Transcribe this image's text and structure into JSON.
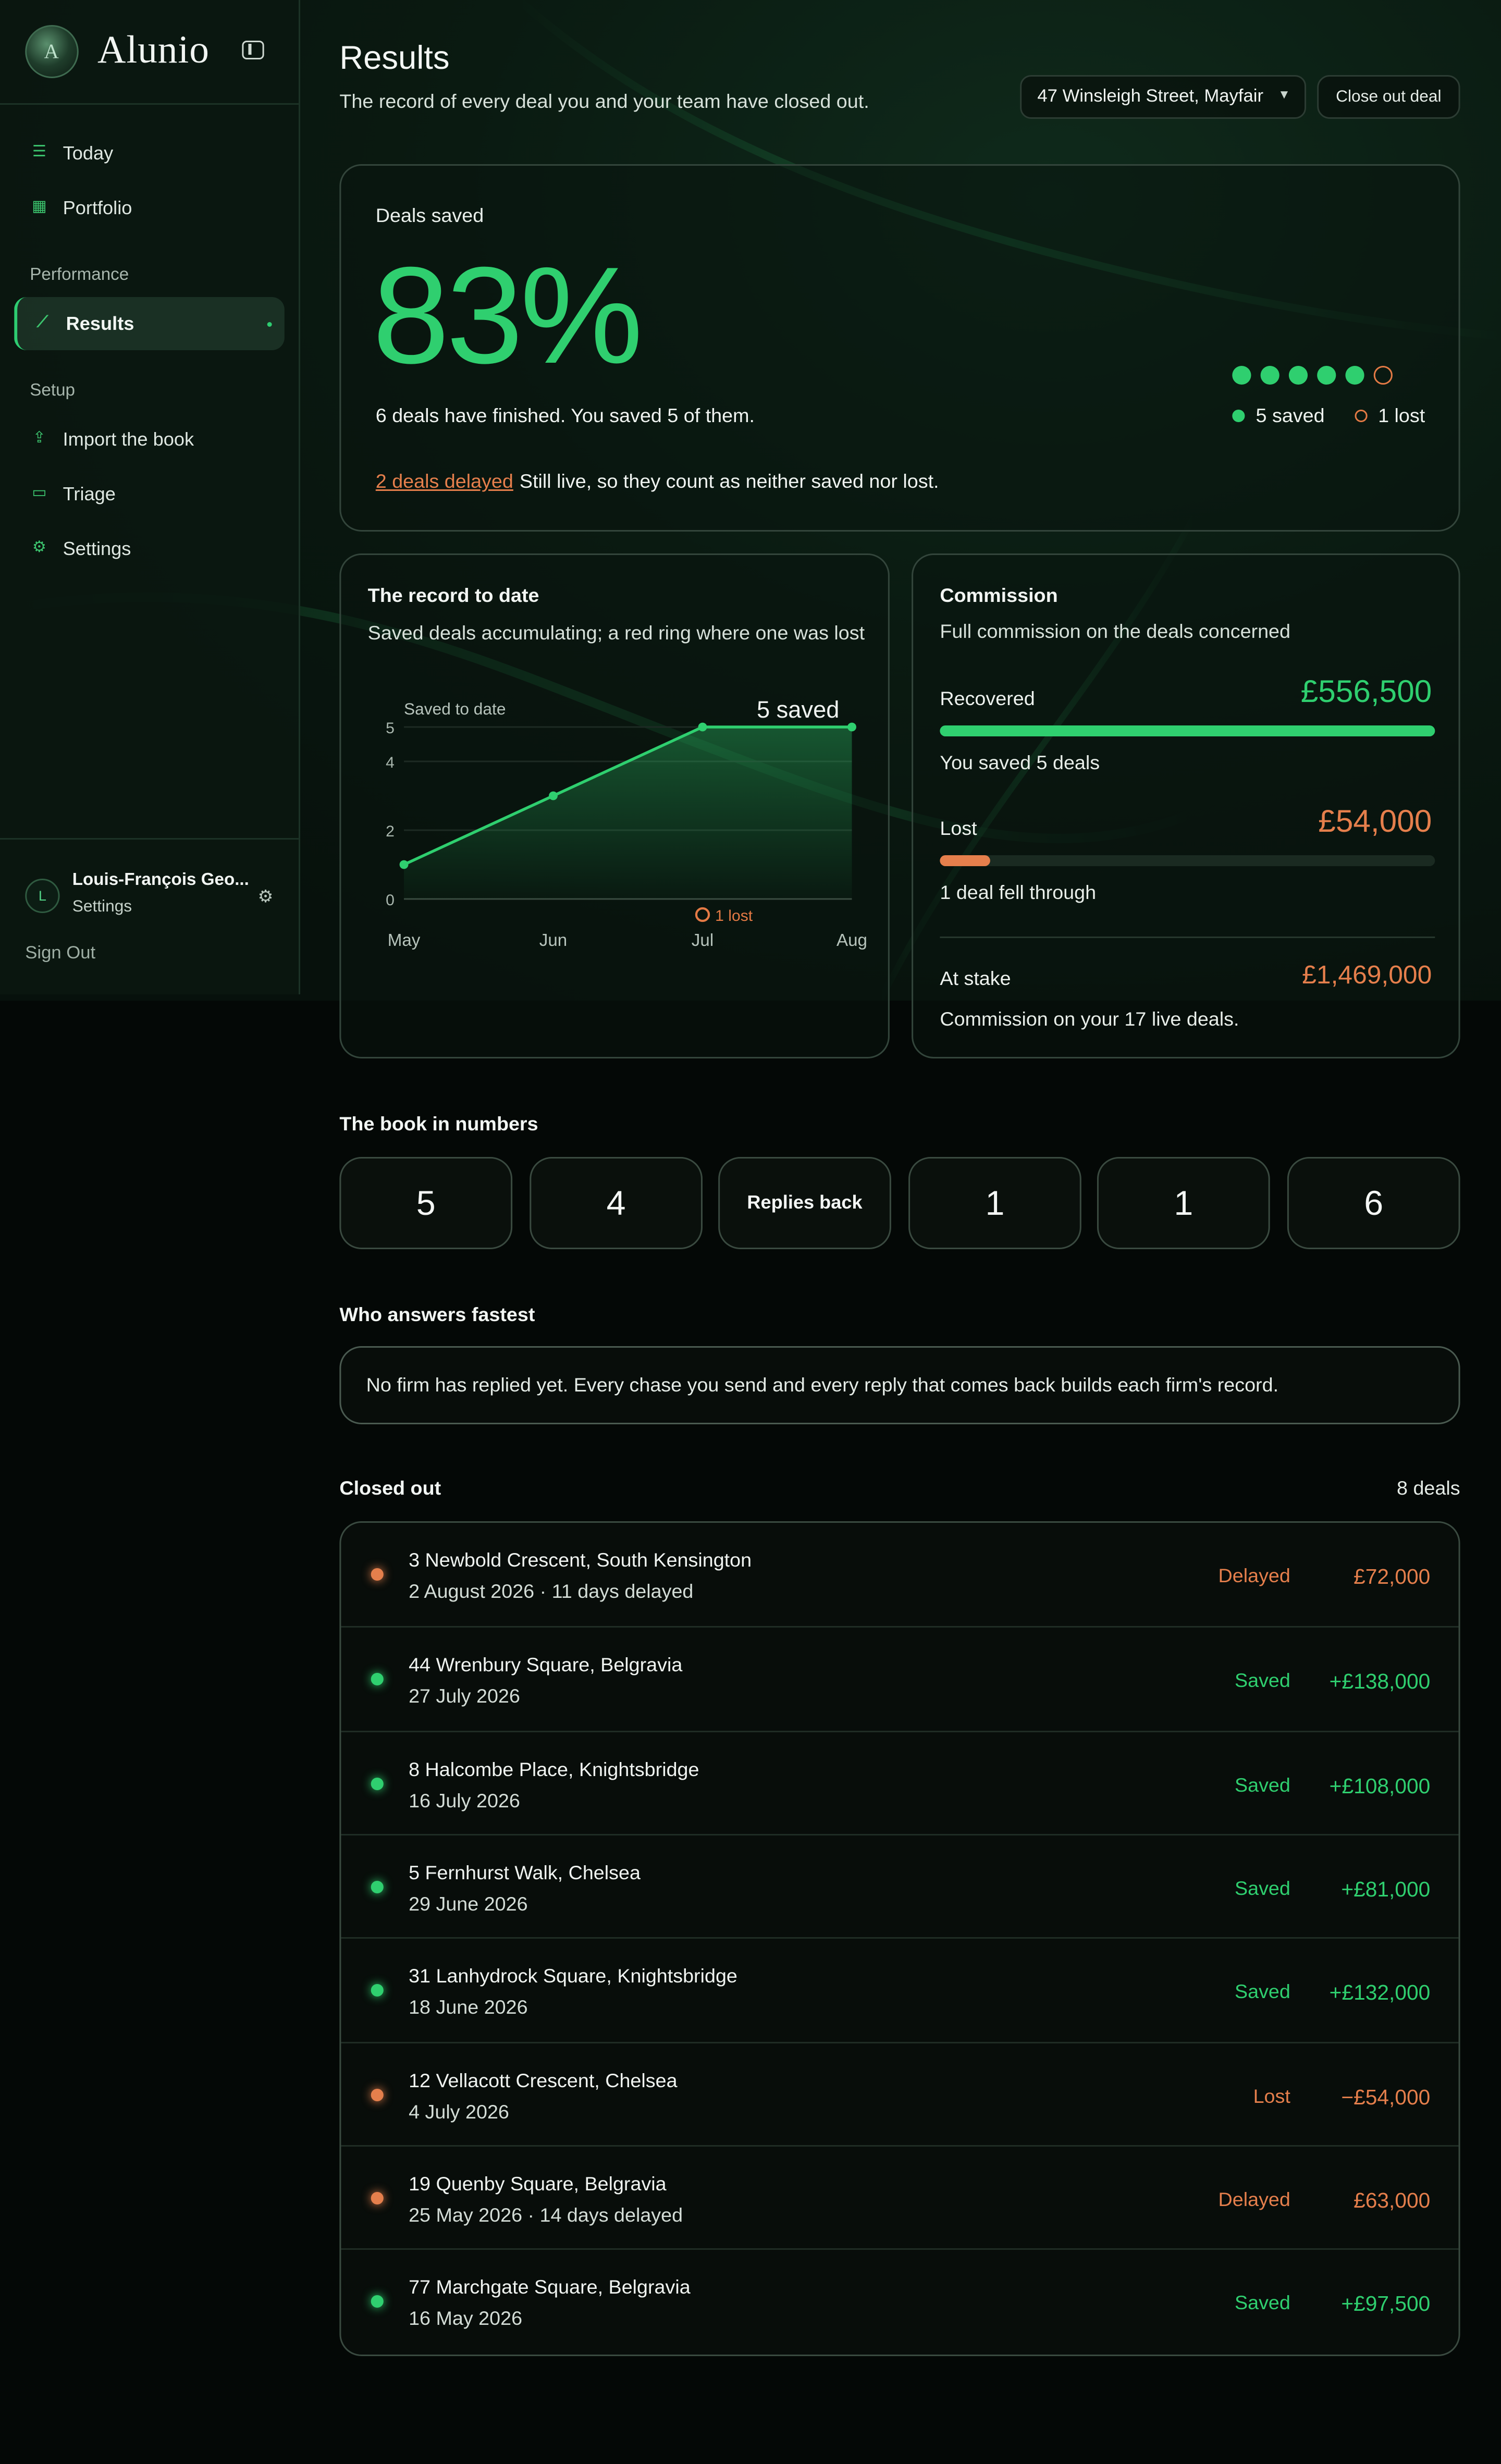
{
  "brand": {
    "name": "Alunio",
    "logo_letter": "A"
  },
  "sidebar": {
    "items_top": [
      {
        "label": "Today",
        "icon": "checklist-icon"
      },
      {
        "label": "Portfolio",
        "icon": "grid-icon"
      }
    ],
    "section_performance": "Performance",
    "active_item": {
      "label": "Results",
      "icon": "trend-icon"
    },
    "section_setup": "Setup",
    "items_setup": [
      {
        "label": "Import the book",
        "icon": "upload-icon"
      },
      {
        "label": "Triage",
        "icon": "inbox-icon"
      },
      {
        "label": "Settings",
        "icon": "gear-icon"
      }
    ],
    "user": {
      "initial": "L",
      "name": "Louis-François Geo...",
      "sub": "Settings"
    },
    "sign_out": "Sign Out"
  },
  "header": {
    "title": "Results",
    "subtitle": "The record of every deal you and your team have closed out.",
    "address_select": "47 Winsleigh Street, Mayfair",
    "close_button": "Close out deal"
  },
  "deals_saved": {
    "label": "Deals saved",
    "percent": "83%",
    "summary": "6 deals have finished. You saved 5 of them.",
    "delayed_link": "2 deals delayed",
    "delayed_text": "Still live, so they count as neither saved nor lost.",
    "saved_count": 5,
    "lost_count": 1,
    "legend_saved": "5 saved",
    "legend_lost": "1 lost",
    "colors": {
      "saved": "#2fcf6f",
      "lost": "#e47a45"
    }
  },
  "record": {
    "title": "The record to date",
    "description": "Saved deals accumulating; a red ring where one was lost"
  },
  "chart_data": {
    "type": "line",
    "title": "Saved to date",
    "x": [
      "May",
      "Jun",
      "Jul",
      "Aug"
    ],
    "series": [
      {
        "name": "Saved to date",
        "values": [
          1,
          3,
          5,
          5
        ]
      }
    ],
    "yticks": [
      "0",
      "2",
      "4",
      "5"
    ],
    "ylim": [
      0,
      5
    ],
    "end_label": "5 saved",
    "lost_marker": {
      "x": "Jul",
      "label": "1 lost"
    },
    "colors": {
      "line": "#2fcf6f",
      "lost": "#e47a45"
    }
  },
  "commission": {
    "title": "Commission",
    "subtitle": "Full commission on the deals concerned",
    "recovered_label": "Recovered",
    "recovered_value": "£556,500",
    "recovered_fill": 1.0,
    "recovered_note": "You saved 5 deals",
    "lost_label": "Lost",
    "lost_value": "£54,000",
    "lost_fill": 0.1,
    "lost_note": "1 deal fell through",
    "stake_label": "At stake",
    "stake_value": "£1,469,000",
    "stake_note": "Commission on your 17 live deals."
  },
  "book_numbers": {
    "heading": "The book in numbers",
    "tiles": [
      "5",
      "4",
      "Replies back",
      "1",
      "1",
      "6"
    ]
  },
  "fastest": {
    "heading": "Who answers fastest",
    "message": "No firm has replied yet. Every chase you send and every reply that comes back builds each firm's record."
  },
  "closed_out": {
    "heading": "Closed out",
    "count": "8 deals",
    "rows": [
      {
        "address": "3 Newbold Crescent, South Kensington",
        "date": "2 August 2026 · 11 days delayed",
        "status": "Delayed",
        "amount": "£72,000",
        "tone": "orange"
      },
      {
        "address": "44 Wrenbury Square, Belgravia",
        "date": "27 July 2026",
        "status": "Saved",
        "amount": "+£138,000",
        "tone": "green"
      },
      {
        "address": "8 Halcombe Place, Knightsbridge",
        "date": "16 July 2026",
        "status": "Saved",
        "amount": "+£108,000",
        "tone": "green"
      },
      {
        "address": "5 Fernhurst Walk, Chelsea",
        "date": "29 June 2026",
        "status": "Saved",
        "amount": "+£81,000",
        "tone": "green"
      },
      {
        "address": "31 Lanhydrock Square, Knightsbridge",
        "date": "18 June 2026",
        "status": "Saved",
        "amount": "+£132,000",
        "tone": "green"
      },
      {
        "address": "12 Vellacott Crescent, Chelsea",
        "date": "4 July 2026",
        "status": "Lost",
        "amount": "−£54,000",
        "tone": "orange"
      },
      {
        "address": "19 Quenby Square, Belgravia",
        "date": "25 May 2026 · 14 days delayed",
        "status": "Delayed",
        "amount": "£63,000",
        "tone": "orange"
      },
      {
        "address": "77 Marchgate Square, Belgravia",
        "date": "16 May 2026",
        "status": "Saved",
        "amount": "+£97,500",
        "tone": "green"
      }
    ]
  }
}
